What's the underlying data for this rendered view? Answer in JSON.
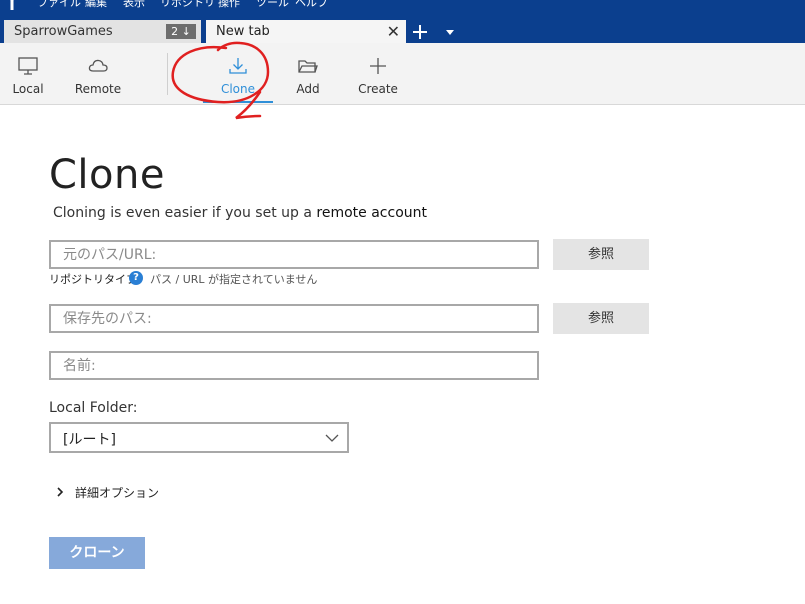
{
  "menubar": {
    "items": [
      "ファイル",
      "編集",
      "表示",
      "リポジトリ",
      "操作",
      "ツール",
      "ヘルプ"
    ]
  },
  "tabs": {
    "repo_tab": {
      "label": "SparrowGames",
      "badge": "2 ↓"
    },
    "new_tab": {
      "label": "New tab",
      "close": "✕"
    },
    "add_tab": "+"
  },
  "toolbar": {
    "local": "Local",
    "remote": "Remote",
    "clone": "Clone",
    "add": "Add",
    "create": "Create"
  },
  "form": {
    "title": "Clone",
    "subtitle_prefix": "Cloning is even easier if you set up a",
    "subtitle_link": "remote account",
    "source_placeholder": "元のパス/URL:",
    "browse_label": "参照",
    "repo_type_label": "リポジトリタイプ:",
    "repo_type_help": "?",
    "repo_type_status": "パス / URL が指定されていません",
    "dest_placeholder": "保存先のパス:",
    "name_placeholder": "名前:",
    "local_folder_label": "Local Folder:",
    "local_folder_value": "[ルート]",
    "advanced_label": "詳細オプション",
    "clone_button": "クローン"
  },
  "colors": {
    "menubar_bg": "#0b3f8e",
    "accent": "#2f8fd8",
    "clone_button_bg": "#86a9da",
    "annotation": "#e02020"
  }
}
